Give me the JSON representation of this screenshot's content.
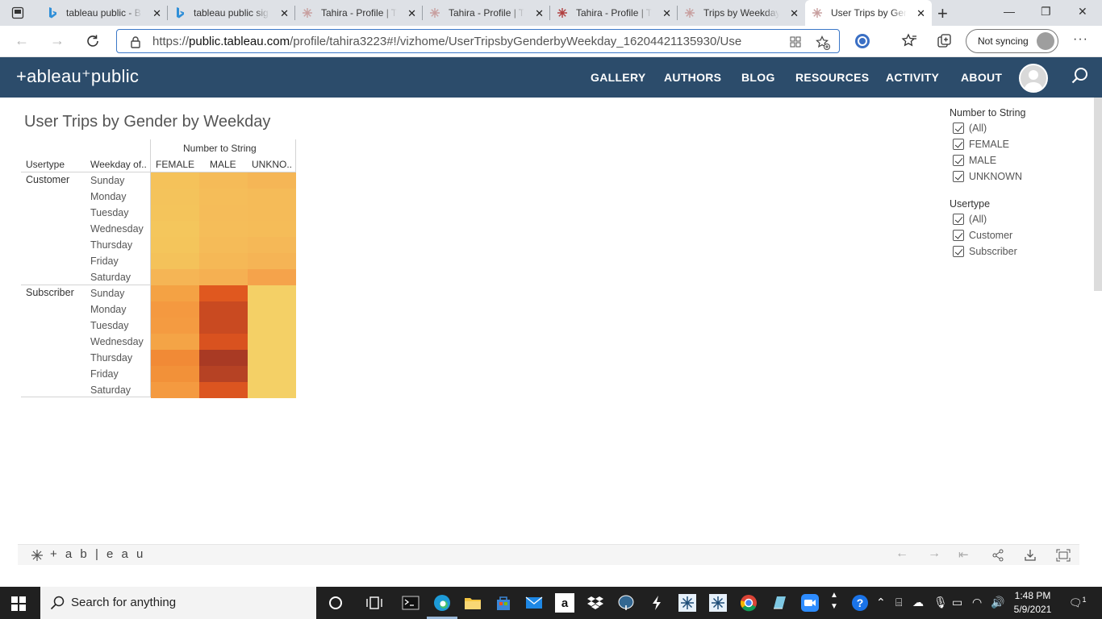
{
  "browser": {
    "tabs": [
      {
        "title": "tableau public - B",
        "favicon": "bing-icon"
      },
      {
        "title": "tableau public sig",
        "favicon": "bing-icon"
      },
      {
        "title": "Tahira - Profile | T",
        "favicon": "tableau-icon"
      },
      {
        "title": "Tahira - Profile | T",
        "favicon": "tableau-icon"
      },
      {
        "title": "Tahira - Profile | T",
        "favicon": "tableau-icon"
      },
      {
        "title": "Trips by Weekday",
        "favicon": "tableau-icon"
      },
      {
        "title": "User Trips by Gen",
        "favicon": "tableau-icon",
        "active": true
      }
    ],
    "url_host": "public.tableau.com",
    "url_prefix": "https://",
    "url_path": "/profile/tahira3223#!/vizhome/UserTripsbyGenderbyWeekday_16204421135930/Use",
    "sync_label": "Not syncing"
  },
  "tableau_header": {
    "logo": "+ableau⁺public",
    "nav": [
      "GALLERY",
      "AUTHORS",
      "BLOG",
      "RESOURCES",
      "ACTIVITY",
      "ABOUT"
    ]
  },
  "viz": {
    "title": "User Trips by Gender by Weekday",
    "column_group_header": "Number to String",
    "row_headers": [
      "Usertype",
      "Weekday of.."
    ],
    "columns": [
      "FEMALE",
      "MALE",
      "UNKNO.."
    ],
    "usertypes": [
      "Customer",
      "Subscriber"
    ],
    "weekdays": [
      "Sunday",
      "Monday",
      "Tuesday",
      "Wednesday",
      "Thursday",
      "Friday",
      "Saturday"
    ],
    "heatmap_colors": {
      "Customer": [
        [
          "#f5c25a",
          "#f5bb58",
          "#f5b656"
        ],
        [
          "#f4c35b",
          "#f5bd59",
          "#f5bb58"
        ],
        [
          "#f4c45b",
          "#f5bc59",
          "#f5bb58"
        ],
        [
          "#f4c65c",
          "#f5bd59",
          "#f5bc58"
        ],
        [
          "#f4c55b",
          "#f5bb58",
          "#f5b857"
        ],
        [
          "#f4c25a",
          "#f5b856",
          "#f5b455"
        ],
        [
          "#f5b555",
          "#f5b052",
          "#f5a34b"
        ]
      ],
      "Subscriber": [
        [
          "#f4a244",
          "#e0581f",
          "#f4d066"
        ],
        [
          "#f49940",
          "#c94a21",
          "#f4d066"
        ],
        [
          "#f49b41",
          "#c94a21",
          "#f4d066"
        ],
        [
          "#f4a446",
          "#d9521f",
          "#f4d066"
        ],
        [
          "#f18a36",
          "#a93a24",
          "#f4d066"
        ],
        [
          "#f29139",
          "#b64224",
          "#f4d066"
        ],
        [
          "#f49a40",
          "#dc5520",
          "#f4d066"
        ]
      ]
    },
    "filters": [
      {
        "title": "Number to String",
        "items": [
          "(All)",
          "FEMALE",
          "MALE",
          "UNKNOWN"
        ]
      },
      {
        "title": "Usertype",
        "items": [
          "(All)",
          "Customer",
          "Subscriber"
        ]
      }
    ],
    "toolbar_logo": "+ a b | e a u"
  },
  "taskbar": {
    "search_placeholder": "Search for anything",
    "time": "1:48 PM",
    "date": "5/9/2021",
    "notification_count": "1"
  }
}
